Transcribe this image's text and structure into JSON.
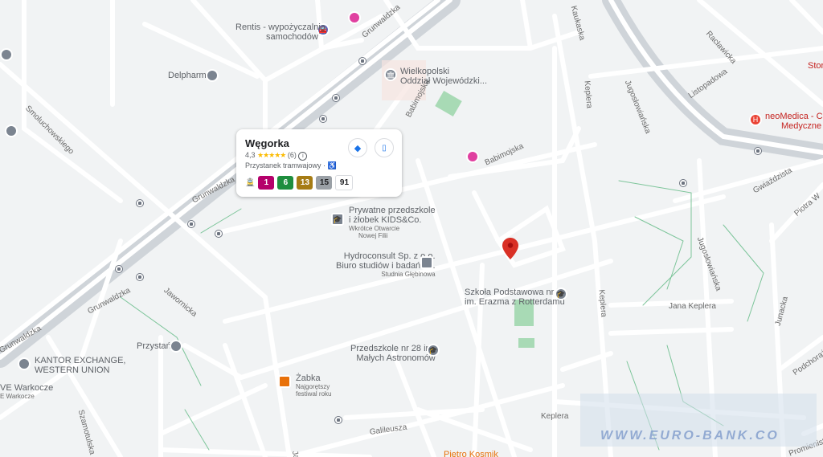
{
  "map": {
    "streets": {
      "grunwaldzka_top": "Grunwaldzka",
      "grunwaldzka_mid": "Grunwaldzka",
      "grunwaldzka_low": "Grunwaldzka",
      "grunwaldzka_left": "Grunwaldzka",
      "smoluchowskiego": "Smoluchowskiego",
      "babimojska_a": "Babimojska",
      "babimojska_b": "Babimojska",
      "jaworowicka": "Jawornicka",
      "szamotulska": "Szamotulska",
      "jugoslowianska_a": "Jugosłowiańska",
      "jugoslowianska_b": "Jugosłowiańska",
      "keplera_a": "Keplera",
      "keplera_b": "Keplera",
      "keplera_c": "Keplera",
      "jana_keplera": "Jana Keplera",
      "raclawicka": "Racławicka",
      "listopadowa": "Listopadowa",
      "gwiazdzista": "Gwiaździsta",
      "piotra_w": "Piotra W",
      "junacka": "Junacka",
      "podchorazych": "Podchorążych",
      "promienista": "Promienista",
      "galileusza": "Galileusza",
      "top_left_street": "Smoluchowskiego",
      "top_mid_street": "Kaukaska",
      "jaw_bottom": "Jaw"
    },
    "pois": {
      "rentis_line1": "Rentis - wypożyczalnia",
      "rentis_line2": "samochodów",
      "wielkopolski_line1": "Wielkopolski",
      "wielkopolski_line2": "Oddział Wojewódzki...",
      "delpharm": "Delpharm",
      "neomedica_line1": "neoMedica - Cen",
      "neomedica_line2": "Medyczne Pozna",
      "stor": "Stor",
      "przedszkole_kids_line1": "Prywatne przedszkole",
      "przedszkole_kids_line2": "i żłobek KIDS&Co.",
      "przedszkole_kids_sub1": "Wkrótce Otwarcie",
      "przedszkole_kids_sub2": "Nowej Filii",
      "hydroconsult_line1": "Hydroconsult Sp. z o.o.",
      "hydroconsult_line2": "Biuro studiów i badań h...",
      "hydroconsult_sub": "Studnia Głębinowa",
      "szkola_line1": "Szkoła Podstawowa nr 7",
      "szkola_line2": "im. Erazma z Rotterdamu",
      "przedszkole28_line1": "Przedszkole nr 28 im.",
      "przedszkole28_line2": "Małych Astronomów",
      "przystan": "Przystań",
      "kantor_line1": "KANTOR EXCHANGE,",
      "kantor_line2": "WESTERN UNION",
      "zabka": "Żabka",
      "zabka_sub1": "Najgorętszy",
      "zabka_sub2": "festiwal roku",
      "warkocze_line1": "VE Warkocze",
      "warkocze_line2": "E Warkocze",
      "pietro": "Piętro Kosmik"
    },
    "card": {
      "title": "Węgorka",
      "rating": "4,3",
      "stars": "★★★★★",
      "reviews": "(6)",
      "type": "Przystanek tramwajowy ·",
      "lines": [
        {
          "label": "1",
          "color": "#b5006b"
        },
        {
          "label": "6",
          "color": "#1e8e3e"
        },
        {
          "label": "13",
          "color": "#a67c14"
        },
        {
          "label": "15",
          "color": "#9aa0a6"
        },
        {
          "label": "91",
          "color": "#ffffff"
        }
      ]
    },
    "watermark": "WWW.EURO-BANK.CO",
    "colors": {
      "background": "#f1f3f4",
      "road": "#ffffff",
      "major_road": "#d0d6dc",
      "park": "#a8dab5",
      "marker": "#d93025",
      "directions": "#1a73e8"
    }
  }
}
